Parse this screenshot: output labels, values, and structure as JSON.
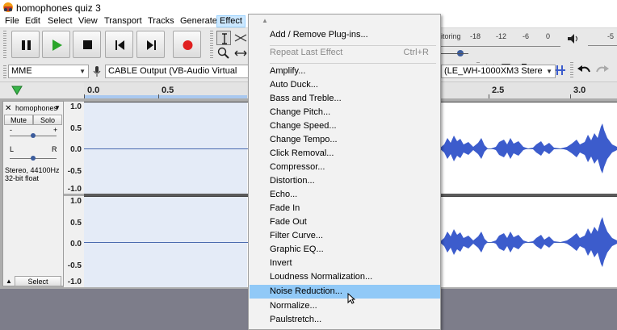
{
  "window": {
    "title": "homophones quiz 3"
  },
  "menubar": [
    "File",
    "Edit",
    "Select",
    "View",
    "Transport",
    "Tracks",
    "Generate",
    "Effect"
  ],
  "device": {
    "host": "MME",
    "output": "CABLE Output (VB-Audio Virtual",
    "output_right": "(LE_WH-1000XM3 Stere"
  },
  "meter": {
    "monitor_label": "itoring",
    "ticks": [
      "-18",
      "-12",
      "-6",
      "0"
    ],
    "right_tick": "-5"
  },
  "ruler": {
    "labels": [
      "0.0",
      "0.5",
      "2.5",
      "3.0"
    ]
  },
  "track": {
    "name": "homophones",
    "mute": "Mute",
    "solo": "Solo",
    "gain_minus": "-",
    "gain_plus": "+",
    "pan_left": "L",
    "pan_right": "R",
    "info_line1": "Stereo, 44100Hz",
    "info_line2": "32-bit float",
    "select": "Select",
    "scale": [
      "1.0",
      "0.5",
      "0.0",
      "-0.5",
      "-1.0"
    ]
  },
  "effect_menu": {
    "items": [
      {
        "label": "Add / Remove Plug-ins...",
        "enabled": true
      },
      {
        "label": "Repeat Last Effect",
        "shortcut": "Ctrl+R",
        "enabled": false
      },
      {
        "label": "Amplify...",
        "enabled": true
      },
      {
        "label": "Auto Duck...",
        "enabled": true
      },
      {
        "label": "Bass and Treble...",
        "enabled": true
      },
      {
        "label": "Change Pitch...",
        "enabled": true
      },
      {
        "label": "Change Speed...",
        "enabled": true
      },
      {
        "label": "Change Tempo...",
        "enabled": true
      },
      {
        "label": "Click Removal...",
        "enabled": true
      },
      {
        "label": "Compressor...",
        "enabled": true
      },
      {
        "label": "Distortion...",
        "enabled": true
      },
      {
        "label": "Echo...",
        "enabled": true
      },
      {
        "label": "Fade In",
        "enabled": true
      },
      {
        "label": "Fade Out",
        "enabled": true
      },
      {
        "label": "Filter Curve...",
        "enabled": true
      },
      {
        "label": "Graphic EQ...",
        "enabled": true
      },
      {
        "label": "Invert",
        "enabled": true
      },
      {
        "label": "Loudness Normalization...",
        "enabled": true
      },
      {
        "label": "Noise Reduction...",
        "enabled": true,
        "highlighted": true
      },
      {
        "label": "Normalize...",
        "enabled": true
      },
      {
        "label": "Paulstretch...",
        "enabled": true
      }
    ]
  },
  "colors": {
    "waveform": "#3c5ccc",
    "menu_highlight": "#91c9f7",
    "selection": "#e4ebf7"
  }
}
